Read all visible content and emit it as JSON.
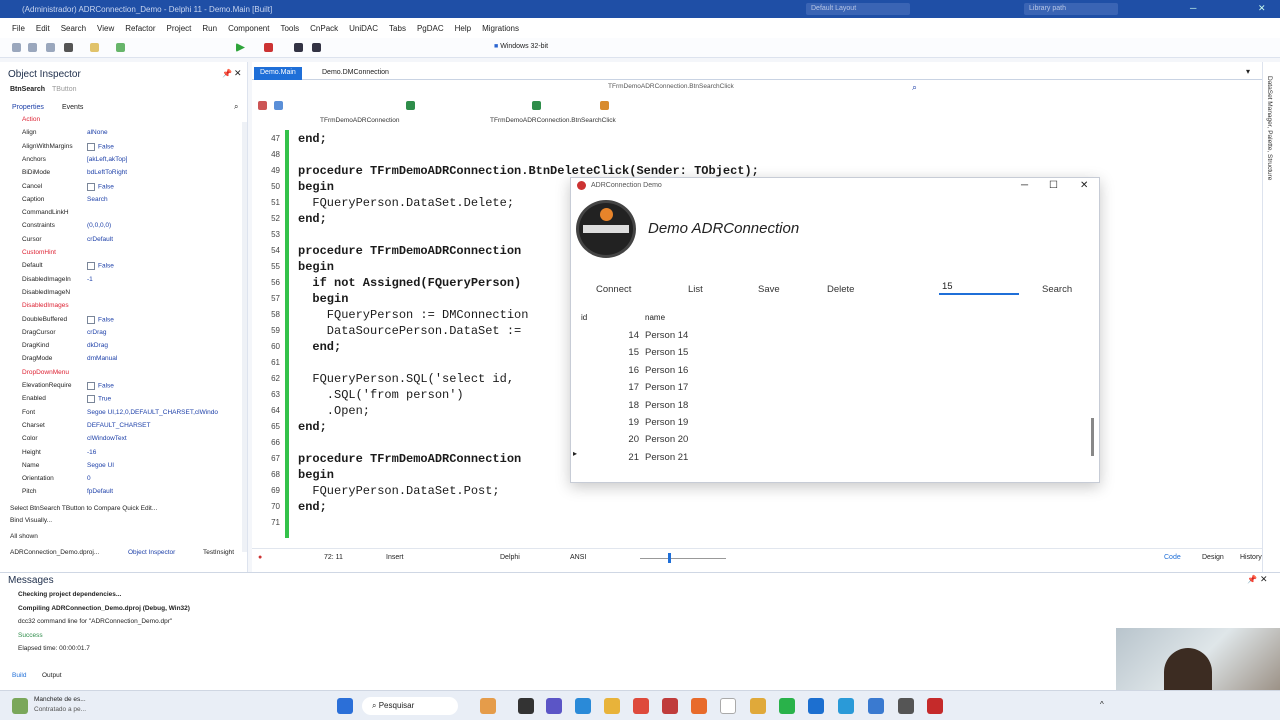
{
  "window": {
    "title": "(Administrador) ADRConnection_Demo - Delphi 11 - Demo.Main [Built]",
    "layout": "Default Layout",
    "search": "Library path"
  },
  "menu": [
    "File",
    "Edit",
    "Search",
    "View",
    "Refactor",
    "Project",
    "Run",
    "Component",
    "Tools",
    "CnPack",
    "UniDAC",
    "Tabs",
    "PgDAC",
    "Help",
    "Migrations"
  ],
  "toolbar": {
    "platform": "Windows 32-bit"
  },
  "object_inspector": {
    "title": "Object Inspector",
    "selected": "BtnSearch",
    "selected_type": "TButton",
    "tabs": [
      "Properties",
      "Events"
    ],
    "props": [
      {
        "n": "Action",
        "v": ""
      },
      {
        "n": "Align",
        "v": "alNone"
      },
      {
        "n": "AlignWithMargins",
        "v": "False",
        "chk": true
      },
      {
        "n": "Anchors",
        "v": "[akLeft,akTop]"
      },
      {
        "n": "BiDiMode",
        "v": "bdLeftToRight"
      },
      {
        "n": "Cancel",
        "v": "False",
        "chk": true
      },
      {
        "n": "Caption",
        "v": "Search"
      },
      {
        "n": "CommandLinkH",
        "v": ""
      },
      {
        "n": "Constraints",
        "v": "(0,0,0,0)"
      },
      {
        "n": "Cursor",
        "v": "crDefault"
      },
      {
        "n": "CustomHint",
        "v": ""
      },
      {
        "n": "Default",
        "v": "False",
        "chk": true
      },
      {
        "n": "DisabledImageIn",
        "v": "-1"
      },
      {
        "n": "DisabledImageN",
        "v": ""
      },
      {
        "n": "DisabledImages",
        "v": ""
      },
      {
        "n": "DoubleBuffered",
        "v": "False",
        "chk": true
      },
      {
        "n": "DragCursor",
        "v": "crDrag"
      },
      {
        "n": "DragKind",
        "v": "dkDrag"
      },
      {
        "n": "DragMode",
        "v": "dmManual"
      },
      {
        "n": "DropDownMenu",
        "v": ""
      },
      {
        "n": "ElevationRequire",
        "v": "False",
        "chk": true
      },
      {
        "n": "Enabled",
        "v": "True",
        "chk": true
      },
      {
        "n": "Font",
        "v": "Segoe UI,12,0,DEFAULT_CHARSET,clWindo"
      },
      {
        "n": "Charset",
        "v": "DEFAULT_CHARSET"
      },
      {
        "n": "Color",
        "v": "clWindowText"
      },
      {
        "n": "Height",
        "v": "-16"
      },
      {
        "n": "Name",
        "v": "Segoe UI"
      },
      {
        "n": "Orientation",
        "v": "0"
      },
      {
        "n": "Pitch",
        "v": "fpDefault"
      }
    ],
    "footer1": "Select BtnSearch TButton to Compare   Quick Edit...",
    "footer2": "Bind Visually...",
    "footer3": "All shown",
    "bottom_tabs": [
      "ADRConnection_Demo.dproj...",
      "Object Inspector",
      "TestInsight"
    ]
  },
  "editor": {
    "tabs": [
      "Demo.Main",
      "Demo.DMConnection"
    ],
    "nav_left": "TFrmDemoADRConnection",
    "nav_right": "TFrmDemoADRConnection.BtnSearchClick",
    "lines": [
      {
        "n": "47",
        "t": "end;"
      },
      {
        "n": "48",
        "t": ""
      },
      {
        "n": "49",
        "t": "procedure TFrmDemoADRConnection.BtnDeleteClick(Sender: TObject);"
      },
      {
        "n": "50",
        "t": "begin"
      },
      {
        "n": "51",
        "t": "  FQueryPerson.DataSet.Delete;"
      },
      {
        "n": "52",
        "t": "end;"
      },
      {
        "n": "53",
        "t": ""
      },
      {
        "n": "54",
        "t": "procedure TFrmDemoADRConnection"
      },
      {
        "n": "55",
        "t": "begin"
      },
      {
        "n": "56",
        "t": "  if not Assigned(FQueryPerson)"
      },
      {
        "n": "57",
        "t": "  begin"
      },
      {
        "n": "58",
        "t": "    FQueryPerson := DMConnection"
      },
      {
        "n": "59",
        "t": "    DataSourcePerson.DataSet :="
      },
      {
        "n": "60",
        "t": "  end;"
      },
      {
        "n": "61",
        "t": ""
      },
      {
        "n": "62",
        "t": "  FQueryPerson.SQL('select id, "
      },
      {
        "n": "63",
        "t": "    .SQL('from person')"
      },
      {
        "n": "64",
        "t": "    .Open;"
      },
      {
        "n": "65",
        "t": "end;"
      },
      {
        "n": "66",
        "t": ""
      },
      {
        "n": "67",
        "t": "procedure TFrmDemoADRConnection"
      },
      {
        "n": "68",
        "t": "begin"
      },
      {
        "n": "69",
        "t": "  FQueryPerson.DataSet.Post;"
      },
      {
        "n": "70",
        "t": "end;"
      },
      {
        "n": "71",
        "t": ""
      }
    ],
    "status": {
      "pos": "72: 11",
      "mode": "Insert",
      "lang": "Delphi",
      "enc": "ANSI"
    },
    "bottom_tabs": [
      "Code",
      "Design",
      "History"
    ],
    "right_panel": "DataSet Manager, Palette, Structure"
  },
  "dialog": {
    "title": "ADRConnection Demo",
    "heading": "Demo ADRConnection",
    "buttons": [
      "Connect",
      "List",
      "Save",
      "Delete"
    ],
    "search_value": "15",
    "search_label": "Search",
    "columns": [
      "id",
      "name"
    ],
    "rows": [
      [
        "14",
        "Person 14"
      ],
      [
        "15",
        "Person 15"
      ],
      [
        "16",
        "Person 16"
      ],
      [
        "17",
        "Person 17"
      ],
      [
        "18",
        "Person 18"
      ],
      [
        "19",
        "Person 19"
      ],
      [
        "20",
        "Person 20"
      ],
      [
        "21",
        "Person 21"
      ]
    ]
  },
  "messages": {
    "title": "Messages",
    "lines": [
      "Checking project dependencies...",
      "Compiling ADRConnection_Demo.dproj (Debug, Win32)",
      "dcc32 command line for \"ADRConnection_Demo.dpr\"",
      "Success",
      "Elapsed time: 00:00:01.7"
    ],
    "tabs": [
      "Build",
      "Output"
    ]
  },
  "taskbar": {
    "weather_title": "Manchete de es...",
    "weather_sub": "Contratado a pe...",
    "search": "Pesquisar"
  },
  "colors": {
    "accent": "#1f4fa6",
    "keyword": "#111111",
    "change_bar": "#34c24a",
    "active_tab": "#1f6fd8"
  }
}
